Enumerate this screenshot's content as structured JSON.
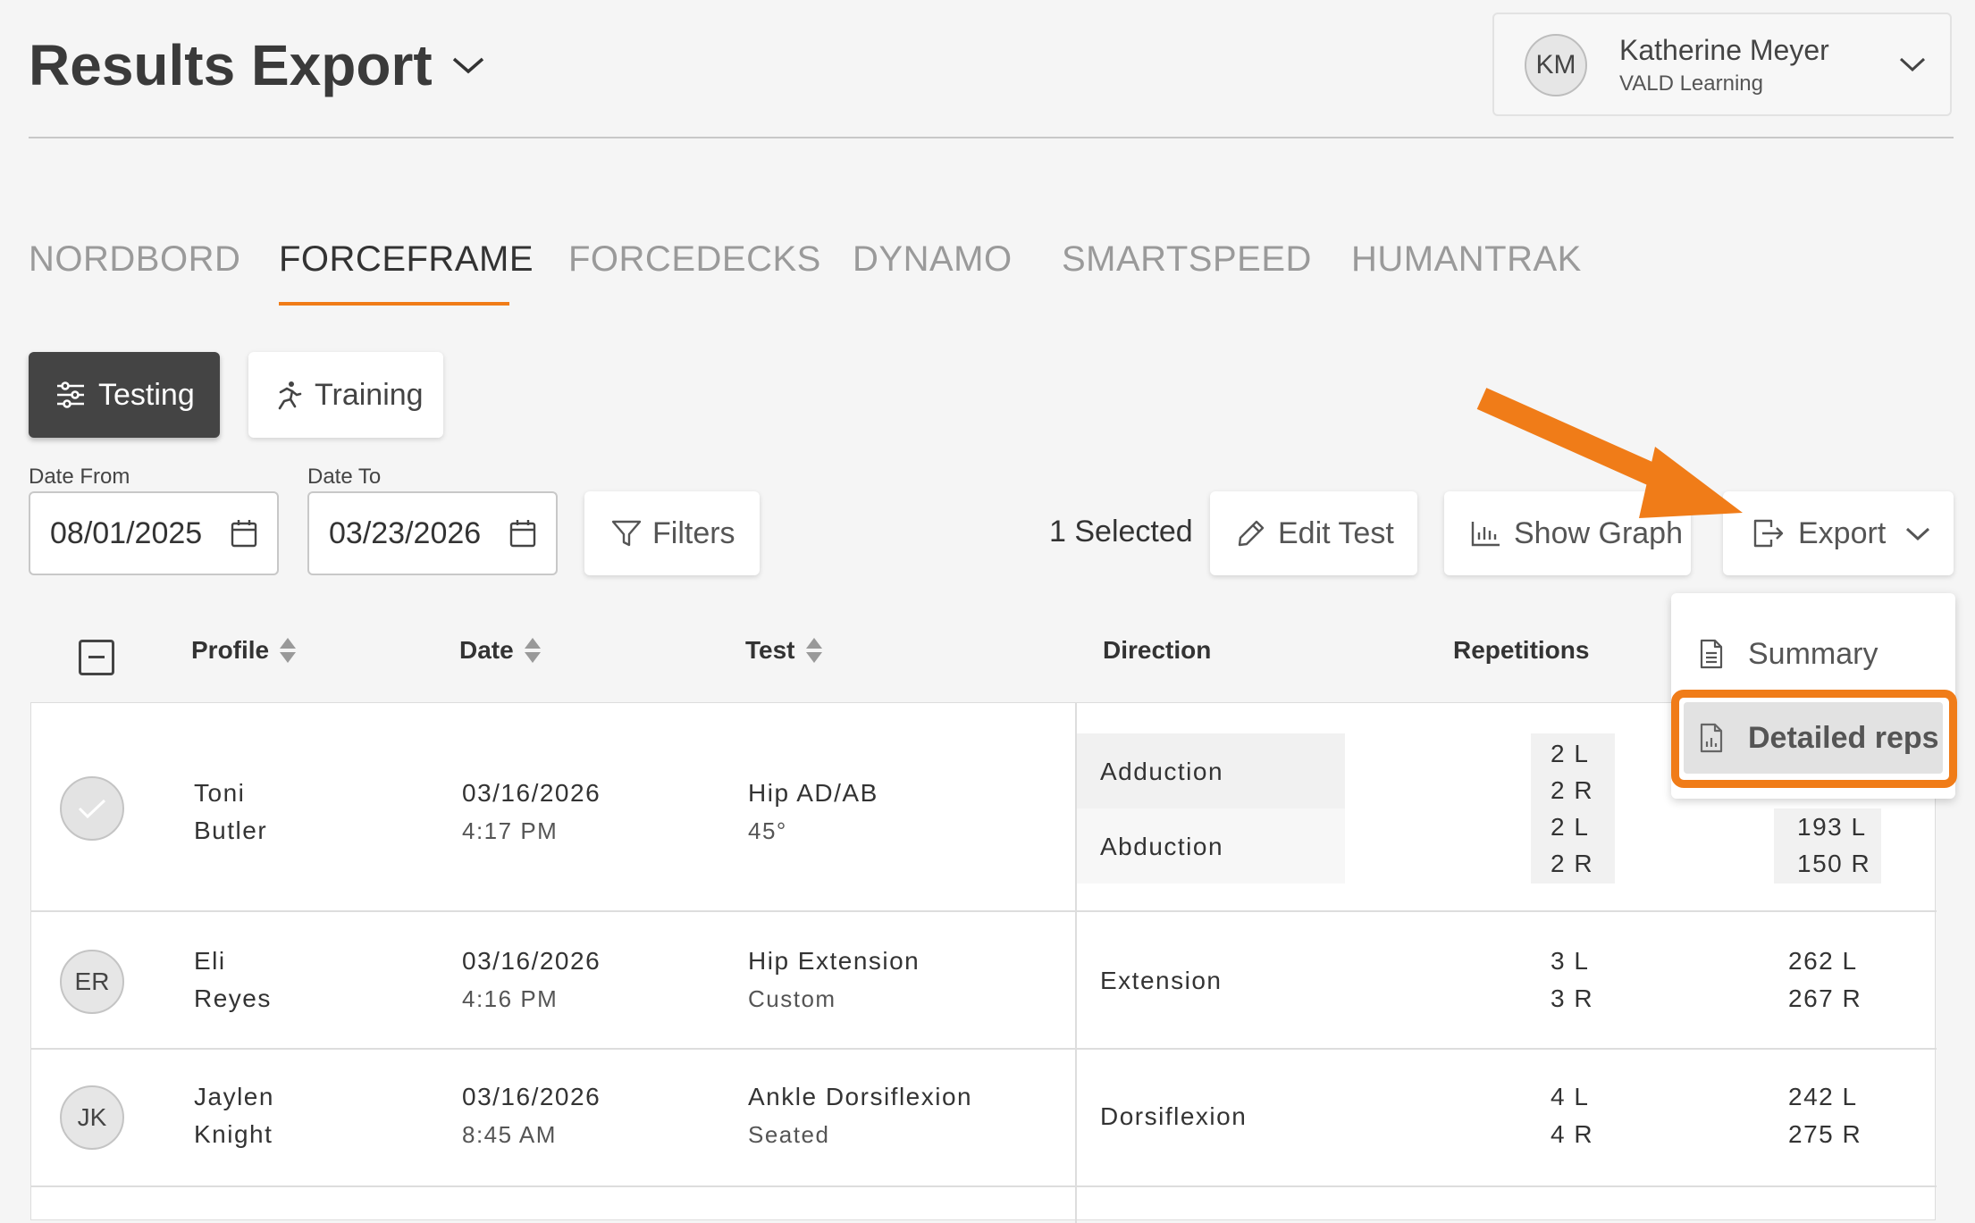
{
  "header": {
    "title": "Results Export"
  },
  "user": {
    "initials": "KM",
    "name": "Katherine Meyer",
    "org": "VALD Learning"
  },
  "tabs": [
    {
      "label": "NORDBORD"
    },
    {
      "label": "FORCEFRAME"
    },
    {
      "label": "FORCEDECKS"
    },
    {
      "label": "DYNAMO"
    },
    {
      "label": "SMARTSPEED"
    },
    {
      "label": "HUMANTRAK"
    }
  ],
  "active_tab": "FORCEFRAME",
  "mode": {
    "testing": "Testing",
    "training": "Training"
  },
  "filters": {
    "date_from_label": "Date From",
    "date_from": "08/01/2025",
    "date_to_label": "Date To",
    "date_to": "03/23/2026",
    "filters_button": "Filters"
  },
  "toolbar": {
    "selected": "1 Selected",
    "edit_test": "Edit Test",
    "show_graph": "Show Graph",
    "export": "Export"
  },
  "export_menu": {
    "summary": "Summary",
    "detailed_reps": "Detailed reps"
  },
  "table": {
    "headers": {
      "profile": "Profile",
      "date": "Date",
      "test": "Test",
      "direction": "Direction",
      "repetitions": "Repetitions"
    },
    "rows": [
      {
        "first": "Toni",
        "last": "Butler",
        "selected": true,
        "date": "03/16/2026",
        "time": "4:17 PM",
        "test": "Hip AD/AB",
        "variant": "45°",
        "directions": [
          "Adduction",
          "Abduction"
        ],
        "reps": [
          [
            "2 L",
            "2 R"
          ],
          [
            "2 L",
            "2 R"
          ]
        ],
        "values": [
          [
            "",
            ""
          ],
          [
            "193 L",
            "150 R"
          ]
        ]
      },
      {
        "initials": "ER",
        "first": "Eli",
        "last": "Reyes",
        "date": "03/16/2026",
        "time": "4:16 PM",
        "test": "Hip Extension",
        "variant": "Custom",
        "direction": "Extension",
        "reps": [
          "3 L",
          "3 R"
        ],
        "values": [
          "262 L",
          "267 R"
        ]
      },
      {
        "initials": "JK",
        "first": "Jaylen",
        "last": "Knight",
        "date": "03/16/2026",
        "time": "8:45 AM",
        "test": "Ankle Dorsiflexion",
        "variant": "Seated",
        "direction": "Dorsiflexion",
        "reps": [
          "4 L",
          "4 R"
        ],
        "values": [
          "242 L",
          "275 R"
        ]
      }
    ]
  },
  "colors": {
    "accent": "#f07c18",
    "dark_button": "#444444",
    "background": "#f5f5f5"
  }
}
